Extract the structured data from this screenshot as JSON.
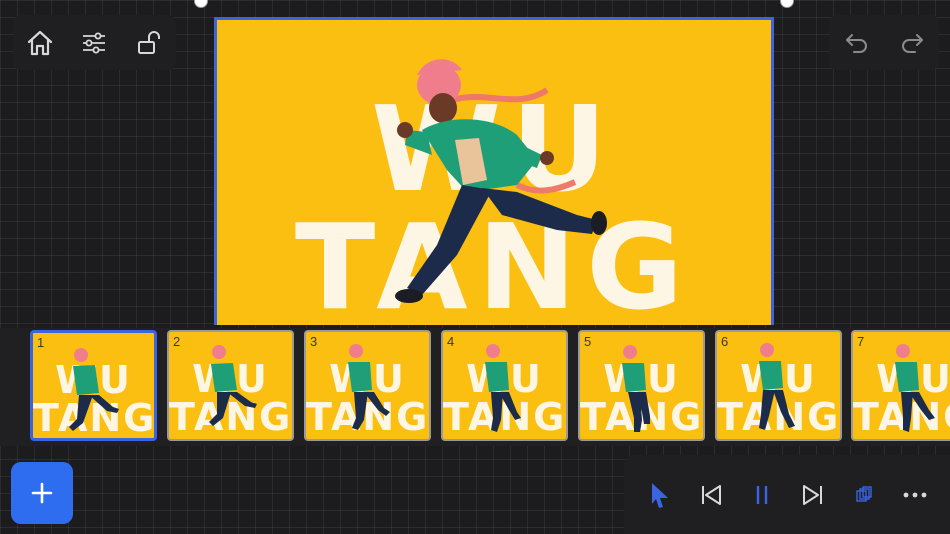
{
  "toolbar_left": {
    "icons": [
      "home-icon",
      "sliders-icon",
      "unlock-icon"
    ]
  },
  "toolbar_right": {
    "icons": [
      "undo-icon",
      "redo-icon"
    ]
  },
  "canvas": {
    "title_text": "WU TANG",
    "background_color": "#fbbf12",
    "selection_color": "#3a64e0"
  },
  "timeline": {
    "selected_frame": 1,
    "frames": [
      {
        "number": "1"
      },
      {
        "number": "2"
      },
      {
        "number": "3"
      },
      {
        "number": "4"
      },
      {
        "number": "5"
      },
      {
        "number": "6"
      },
      {
        "number": "7"
      }
    ],
    "frame_title": "WU TANG"
  },
  "add_button": {
    "label": "+",
    "color": "#2f6df0"
  },
  "playbar": {
    "icons": [
      "select-arrow-icon",
      "previous-frame-icon",
      "pause-icon",
      "next-frame-icon",
      "onion-skin-icon",
      "more-icon"
    ],
    "accent": "#3a64e0"
  }
}
